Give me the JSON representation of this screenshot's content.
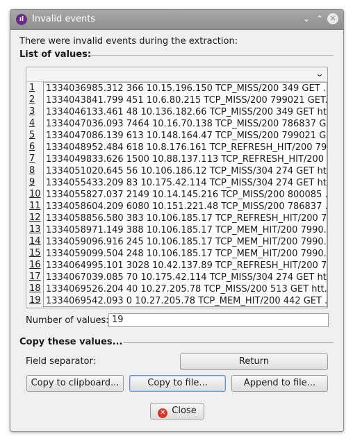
{
  "window": {
    "title": "Invalid events"
  },
  "intro": "There were invalid events during the extraction:",
  "list_section": {
    "title": "List of values:",
    "row_numbers": [
      "1",
      "2",
      "3",
      "4",
      "5",
      "6",
      "7",
      "8",
      "9",
      "10",
      "11",
      "12",
      "13",
      "14",
      "15",
      "16",
      "17",
      "18",
      "19"
    ],
    "lines": [
      "1334036985.312 366 10.15.196.150 TCP_MISS/200 349 GET ...",
      "1334043841.799 451 10.6.80.215 TCP_MISS/200 799021 GET...",
      "1334046133.461 48 10.136.182.66 TCP_MISS/200 349 GET ht...",
      "1334047036.093 7464 10.16.70.138 TCP_MISS/200 786837 G...",
      "1334047086.139 613 10.148.164.47 TCP_MISS/200 799021 G...",
      "1334048952.484 618 10.8.176.161 TCP_REFRESH_HIT/200 79...",
      "1334049833.626 1500 10.88.137.113 TCP_REFRESH_HIT/200 ...",
      "1334051020.645 56 10.106.186.12 TCP_MISS/304 274 GET htt...",
      "1334055433.209 83 10.175.42.114 TCP_MISS/304 274 GET htt...",
      "1334055827.037 2149 10.14.145.216 TCP_MISS/200 800085 ...",
      "1334058604.209 6080 10.151.221.48 TCP_MISS/200 786837 ...",
      "1334058856.580 383 10.106.185.17 TCP_REFRESH_HIT/200 7...",
      "1334058971.149 388 10.106.185.17 TCP_MEM_HIT/200 7990...",
      "1334059096.916 245 10.106.185.17 TCP_MEM_HIT/200 7990...",
      "1334059099.504 248 10.106.185.17 TCP_MEM_HIT/200 7990...",
      "1334064995.101 3028 10.42.137.89 TCP_REFRESH_HIT/200 7...",
      "1334067039.085 70 10.175.42.114 TCP_MISS/304 274 GET htt...",
      "1334069526.204 40 10.27.205.78 TCP_MISS/200 513 GET htt...",
      "1334069542.093 0 10.27.205.78 TCP_MEM_HIT/200 442 GET ..."
    ]
  },
  "number_of_values": {
    "label": "Number of values:",
    "value": "19"
  },
  "copy_section": {
    "title": "Copy these values...",
    "separator_label": "Field separator:",
    "separator_value": "Return",
    "copy_clipboard": "Copy to clipboard...",
    "copy_file": "Copy to file...",
    "append_file": "Append to file..."
  },
  "close_button": "Close",
  "colors": {
    "titlebar": "#9b9b9b",
    "accent": "#6b2a86",
    "close_red": "#d23a2c"
  }
}
